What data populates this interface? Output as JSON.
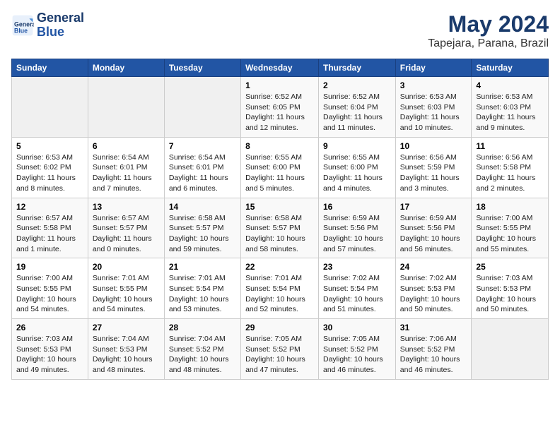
{
  "logo": {
    "line1": "General",
    "line2": "Blue"
  },
  "title": "May 2024",
  "location": "Tapejara, Parana, Brazil",
  "days_of_week": [
    "Sunday",
    "Monday",
    "Tuesday",
    "Wednesday",
    "Thursday",
    "Friday",
    "Saturday"
  ],
  "weeks": [
    [
      {
        "num": "",
        "info": ""
      },
      {
        "num": "",
        "info": ""
      },
      {
        "num": "",
        "info": ""
      },
      {
        "num": "1",
        "info": "Sunrise: 6:52 AM\nSunset: 6:05 PM\nDaylight: 11 hours and 12 minutes."
      },
      {
        "num": "2",
        "info": "Sunrise: 6:52 AM\nSunset: 6:04 PM\nDaylight: 11 hours and 11 minutes."
      },
      {
        "num": "3",
        "info": "Sunrise: 6:53 AM\nSunset: 6:03 PM\nDaylight: 11 hours and 10 minutes."
      },
      {
        "num": "4",
        "info": "Sunrise: 6:53 AM\nSunset: 6:03 PM\nDaylight: 11 hours and 9 minutes."
      }
    ],
    [
      {
        "num": "5",
        "info": "Sunrise: 6:53 AM\nSunset: 6:02 PM\nDaylight: 11 hours and 8 minutes."
      },
      {
        "num": "6",
        "info": "Sunrise: 6:54 AM\nSunset: 6:01 PM\nDaylight: 11 hours and 7 minutes."
      },
      {
        "num": "7",
        "info": "Sunrise: 6:54 AM\nSunset: 6:01 PM\nDaylight: 11 hours and 6 minutes."
      },
      {
        "num": "8",
        "info": "Sunrise: 6:55 AM\nSunset: 6:00 PM\nDaylight: 11 hours and 5 minutes."
      },
      {
        "num": "9",
        "info": "Sunrise: 6:55 AM\nSunset: 6:00 PM\nDaylight: 11 hours and 4 minutes."
      },
      {
        "num": "10",
        "info": "Sunrise: 6:56 AM\nSunset: 5:59 PM\nDaylight: 11 hours and 3 minutes."
      },
      {
        "num": "11",
        "info": "Sunrise: 6:56 AM\nSunset: 5:58 PM\nDaylight: 11 hours and 2 minutes."
      }
    ],
    [
      {
        "num": "12",
        "info": "Sunrise: 6:57 AM\nSunset: 5:58 PM\nDaylight: 11 hours and 1 minute."
      },
      {
        "num": "13",
        "info": "Sunrise: 6:57 AM\nSunset: 5:57 PM\nDaylight: 11 hours and 0 minutes."
      },
      {
        "num": "14",
        "info": "Sunrise: 6:58 AM\nSunset: 5:57 PM\nDaylight: 10 hours and 59 minutes."
      },
      {
        "num": "15",
        "info": "Sunrise: 6:58 AM\nSunset: 5:57 PM\nDaylight: 10 hours and 58 minutes."
      },
      {
        "num": "16",
        "info": "Sunrise: 6:59 AM\nSunset: 5:56 PM\nDaylight: 10 hours and 57 minutes."
      },
      {
        "num": "17",
        "info": "Sunrise: 6:59 AM\nSunset: 5:56 PM\nDaylight: 10 hours and 56 minutes."
      },
      {
        "num": "18",
        "info": "Sunrise: 7:00 AM\nSunset: 5:55 PM\nDaylight: 10 hours and 55 minutes."
      }
    ],
    [
      {
        "num": "19",
        "info": "Sunrise: 7:00 AM\nSunset: 5:55 PM\nDaylight: 10 hours and 54 minutes."
      },
      {
        "num": "20",
        "info": "Sunrise: 7:01 AM\nSunset: 5:55 PM\nDaylight: 10 hours and 54 minutes."
      },
      {
        "num": "21",
        "info": "Sunrise: 7:01 AM\nSunset: 5:54 PM\nDaylight: 10 hours and 53 minutes."
      },
      {
        "num": "22",
        "info": "Sunrise: 7:01 AM\nSunset: 5:54 PM\nDaylight: 10 hours and 52 minutes."
      },
      {
        "num": "23",
        "info": "Sunrise: 7:02 AM\nSunset: 5:54 PM\nDaylight: 10 hours and 51 minutes."
      },
      {
        "num": "24",
        "info": "Sunrise: 7:02 AM\nSunset: 5:53 PM\nDaylight: 10 hours and 50 minutes."
      },
      {
        "num": "25",
        "info": "Sunrise: 7:03 AM\nSunset: 5:53 PM\nDaylight: 10 hours and 50 minutes."
      }
    ],
    [
      {
        "num": "26",
        "info": "Sunrise: 7:03 AM\nSunset: 5:53 PM\nDaylight: 10 hours and 49 minutes."
      },
      {
        "num": "27",
        "info": "Sunrise: 7:04 AM\nSunset: 5:53 PM\nDaylight: 10 hours and 48 minutes."
      },
      {
        "num": "28",
        "info": "Sunrise: 7:04 AM\nSunset: 5:52 PM\nDaylight: 10 hours and 48 minutes."
      },
      {
        "num": "29",
        "info": "Sunrise: 7:05 AM\nSunset: 5:52 PM\nDaylight: 10 hours and 47 minutes."
      },
      {
        "num": "30",
        "info": "Sunrise: 7:05 AM\nSunset: 5:52 PM\nDaylight: 10 hours and 46 minutes."
      },
      {
        "num": "31",
        "info": "Sunrise: 7:06 AM\nSunset: 5:52 PM\nDaylight: 10 hours and 46 minutes."
      },
      {
        "num": "",
        "info": ""
      }
    ]
  ]
}
